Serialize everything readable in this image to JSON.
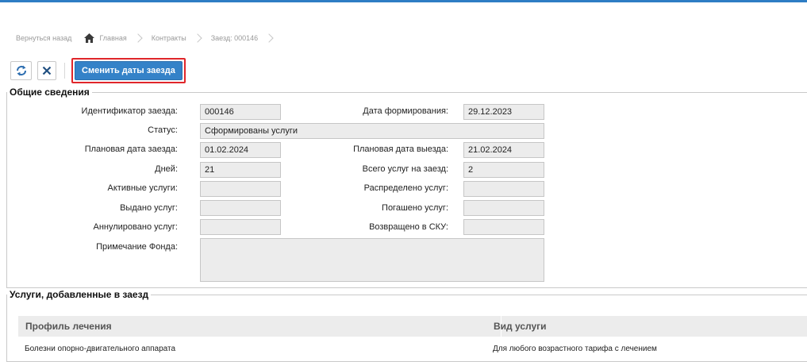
{
  "colors": {
    "accent": "#2e7dc4",
    "button": "#3482c8",
    "highlight": "#e0262a"
  },
  "breadcrumb": {
    "back": "Вернуться назад",
    "home": "Главная",
    "contracts": "Контракты",
    "current": "Заезд: 000146"
  },
  "toolbar": {
    "refresh_icon": "refresh-icon",
    "close_icon": "close-icon",
    "change_dates_label": "Сменить даты заезда"
  },
  "general": {
    "title": "Общие сведения",
    "fields": {
      "id_label": "Идентификатор заезда:",
      "id_value": "000146",
      "formed_label": "Дата формирования:",
      "formed_value": "29.12.2023",
      "status_label": "Статус:",
      "status_value": "Сформированы услуги",
      "plan_in_label": "Плановая дата заезда:",
      "plan_in_value": "01.02.2024",
      "plan_out_label": "Плановая дата выезда:",
      "plan_out_value": "21.02.2024",
      "days_label": "Дней:",
      "days_value": "21",
      "total_services_label": "Всего услуг на заезд:",
      "total_services_value": "2",
      "active_label": "Активные услуги:",
      "active_value": "",
      "distributed_label": "Распределено услуг:",
      "distributed_value": "",
      "issued_label": "Выдано услуг:",
      "issued_value": "",
      "redeemed_label": "Погашено услуг:",
      "redeemed_value": "",
      "cancelled_label": "Аннулировано услуг:",
      "cancelled_value": "",
      "returned_label": "Возвращено в СКУ:",
      "returned_value": "",
      "note_label": "Примечание Фонда:",
      "note_value": ""
    }
  },
  "services": {
    "title": "Услуги, добавленные в заезд",
    "columns": [
      "Профиль лечения",
      "Вид услуги"
    ],
    "rows": [
      [
        "Болезни опорно-двигательного аппарата",
        "Для любого возрастного тарифа с лечением"
      ]
    ]
  }
}
